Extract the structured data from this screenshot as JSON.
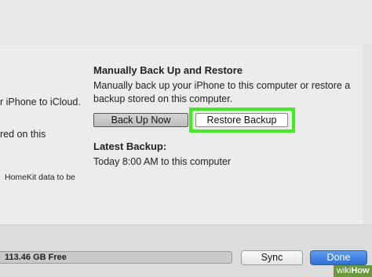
{
  "backup_section": {
    "title": "Manually Back Up and Restore",
    "description_line1": "Manually back up your iPhone to this computer or restore a",
    "description_line2": "backup stored on this computer.",
    "back_up_now_label": "Back Up Now",
    "restore_backup_label": "Restore Backup",
    "latest_backup_title": "Latest Backup:",
    "latest_backup_value": "Today 8:00 AM to this computer"
  },
  "left_column": {
    "line1": "r iPhone to iCloud.",
    "line2": "red on this",
    "line3": "HomeKit data to be"
  },
  "footer": {
    "storage_free": "113.46 GB Free",
    "sync_label": "Sync",
    "done_label": "Done"
  },
  "watermark": {
    "part1": "wiki",
    "part2": "How"
  },
  "colors": {
    "highlight": "#3cf01c",
    "done_button": "#2f6fd6"
  }
}
